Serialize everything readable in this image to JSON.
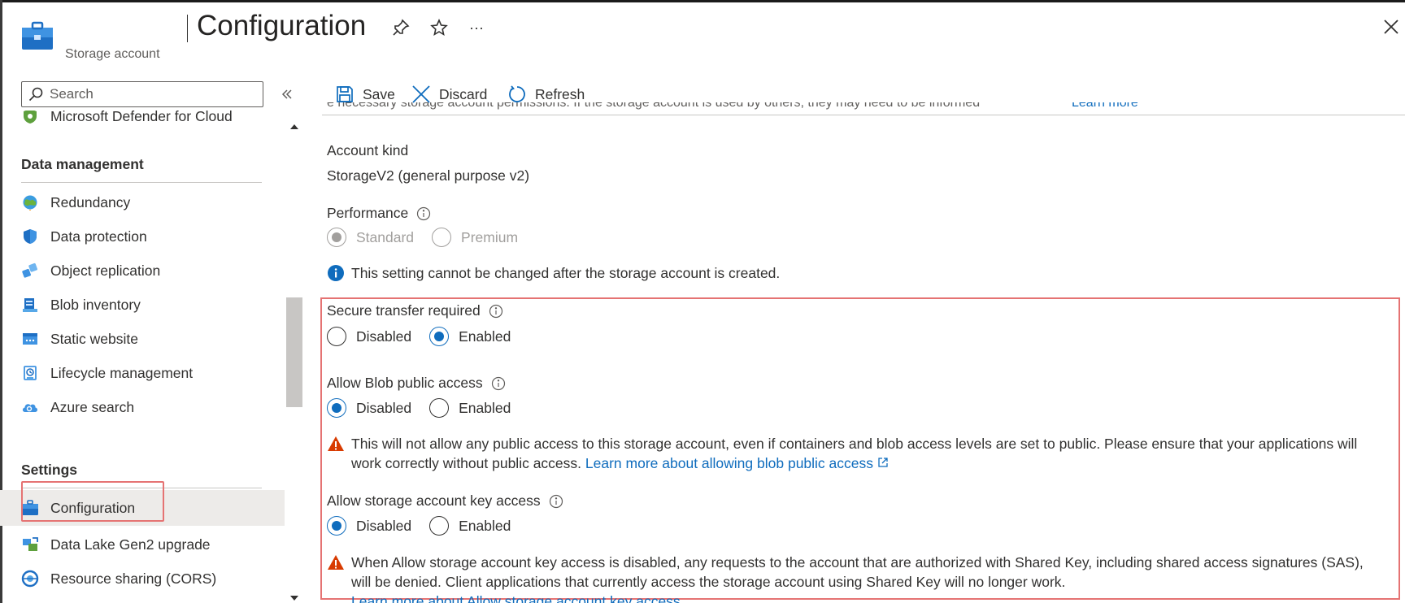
{
  "header": {
    "resource_type": "Storage account",
    "title": "Configuration",
    "pin_icon": "pin-icon",
    "star_icon": "star-icon",
    "more_label": "···",
    "close_icon": "close-icon"
  },
  "search": {
    "placeholder": "Search"
  },
  "sidebar": {
    "top_partial_item": "Microsoft Defender for Cloud",
    "groups": [
      {
        "label": "Data management",
        "items": [
          {
            "label": "Redundancy",
            "icon": "globe-icon"
          },
          {
            "label": "Data protection",
            "icon": "shield-icon"
          },
          {
            "label": "Object replication",
            "icon": "replication-icon"
          },
          {
            "label": "Blob inventory",
            "icon": "inventory-icon"
          },
          {
            "label": "Static website",
            "icon": "website-icon"
          },
          {
            "label": "Lifecycle management",
            "icon": "lifecycle-icon"
          },
          {
            "label": "Azure search",
            "icon": "cloud-search-icon"
          }
        ]
      },
      {
        "label": "Settings",
        "items": [
          {
            "label": "Configuration",
            "icon": "storage-briefcase-icon",
            "selected": true
          },
          {
            "label": "Data Lake Gen2 upgrade",
            "icon": "data-lake-icon"
          },
          {
            "label": "Resource sharing (CORS)",
            "icon": "cors-icon"
          }
        ]
      }
    ]
  },
  "toolbar": {
    "save_label": "Save",
    "discard_label": "Discard",
    "refresh_label": "Refresh"
  },
  "content": {
    "cut_text": "e necessary storage account permissions. If the storage account is used by others, they may need to be informed",
    "cut_link": "Learn more",
    "account_kind": {
      "label": "Account kind",
      "value": "StorageV2 (general purpose v2)"
    },
    "performance": {
      "label": "Performance",
      "options": [
        "Standard",
        "Premium"
      ],
      "selected": "Standard",
      "disabled": true,
      "note": "This setting cannot be changed after the storage account is created."
    },
    "secure_transfer": {
      "label": "Secure transfer required",
      "options": [
        "Disabled",
        "Enabled"
      ],
      "selected": "Enabled"
    },
    "blob_public_access": {
      "label": "Allow Blob public access",
      "options": [
        "Disabled",
        "Enabled"
      ],
      "selected": "Disabled",
      "warning_line1": "This will not allow any public access to this storage account, even if containers and blob access levels are set to public. Please ensure that your applications will",
      "warning_line2": "work correctly without public access.",
      "warning_link": "Learn more about allowing blob public access"
    },
    "key_access": {
      "label": "Allow storage account key access",
      "options": [
        "Disabled",
        "Enabled"
      ],
      "selected": "Disabled",
      "warning_line1": "When Allow storage account key access is disabled, any requests to the account that are authorized with Shared Key, including shared access signatures (SAS),",
      "warning_line2": "will be denied. Client applications that currently access the storage account using Shared Key will no longer work.",
      "warning_link": "Learn more about Allow storage account key access"
    }
  },
  "colors": {
    "accent": "#0f6cbd",
    "highlight_border": "#e57373",
    "warning": "#d83b01",
    "selected_bg": "#edebe9"
  }
}
